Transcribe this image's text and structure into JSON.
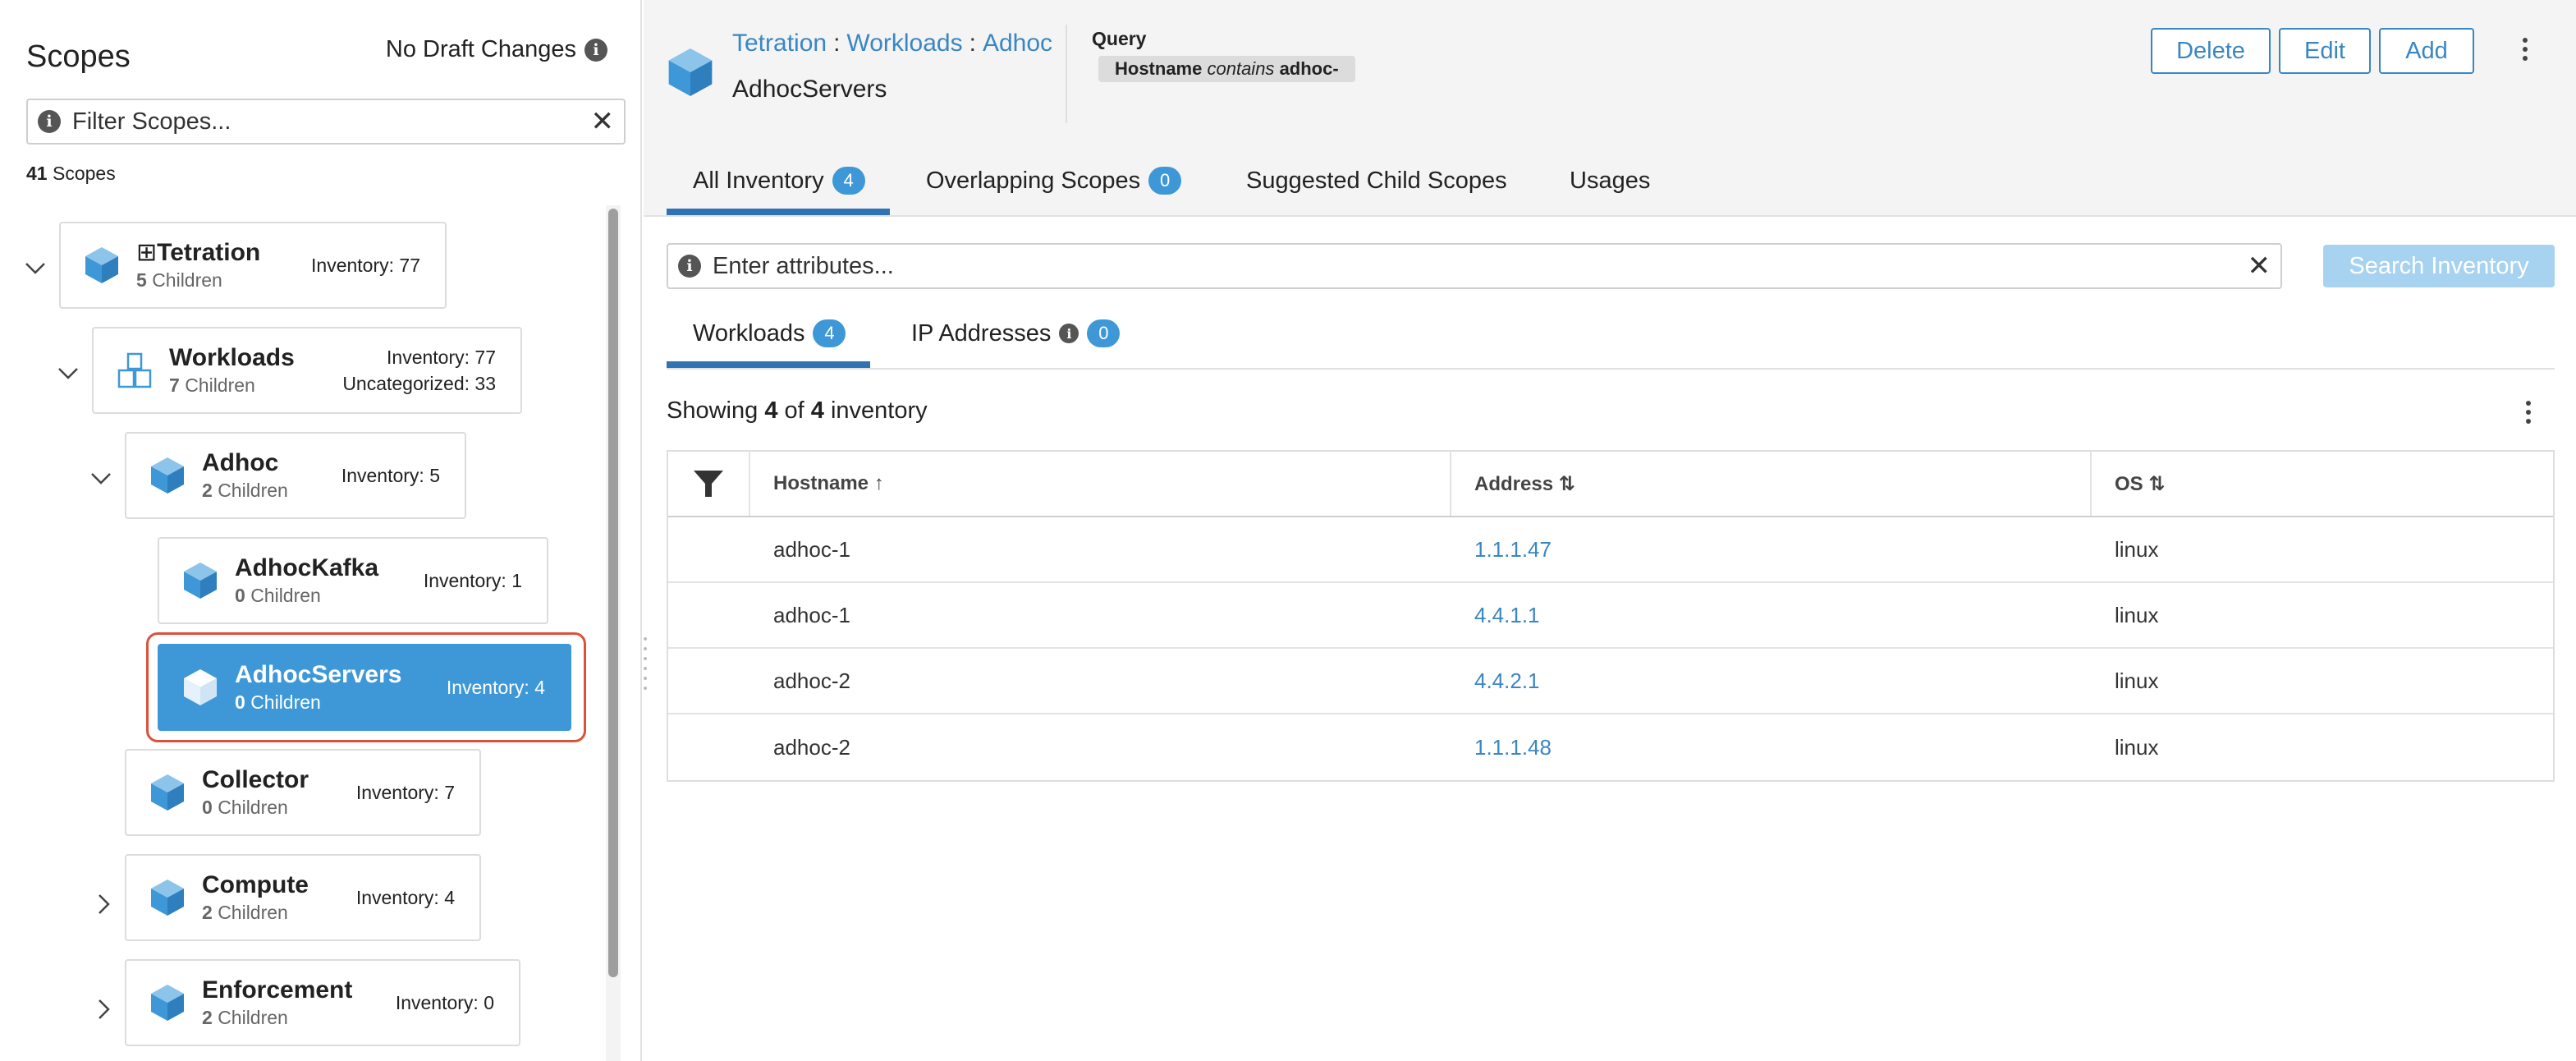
{
  "sidebar": {
    "title": "Scopes",
    "draft_status": "No Draft Changes",
    "filter_placeholder": "Filter Scopes...",
    "scope_count_number": "41",
    "scope_count_label": "Scopes",
    "nodes": [
      {
        "name": "Tetration",
        "children_num": "5",
        "children_label": "Children",
        "inventory": "Inventory: 77",
        "expanded": true
      },
      {
        "name": "Workloads",
        "children_num": "7",
        "children_label": "Children",
        "inventory": "Inventory: 77",
        "uncategorized": "Uncategorized: 33",
        "expanded": true
      },
      {
        "name": "Adhoc",
        "children_num": "2",
        "children_label": "Children",
        "inventory": "Inventory: 5",
        "expanded": true
      },
      {
        "name": "AdhocKafka",
        "children_num": "0",
        "children_label": "Children",
        "inventory": "Inventory: 1"
      },
      {
        "name": "AdhocServers",
        "children_num": "0",
        "children_label": "Children",
        "inventory": "Inventory: 4",
        "selected": true
      },
      {
        "name": "Collector",
        "children_num": "0",
        "children_label": "Children",
        "inventory": "Inventory: 7"
      },
      {
        "name": "Compute",
        "children_num": "2",
        "children_label": "Children",
        "inventory": "Inventory: 4",
        "expanded": false
      },
      {
        "name": "Enforcement",
        "children_num": "2",
        "children_label": "Children",
        "inventory": "Inventory: 0",
        "expanded": false
      }
    ]
  },
  "header": {
    "breadcrumb": [
      "Tetration",
      "Workloads",
      "Adhoc"
    ],
    "breadcrumb_sep": ":",
    "scope_name": "AdhocServers",
    "query_title": "Query",
    "query_field": "Hostname",
    "query_op": "contains",
    "query_value": "adhoc-",
    "buttons": {
      "delete": "Delete",
      "edit": "Edit",
      "add": "Add"
    }
  },
  "tabs": [
    {
      "label": "All Inventory",
      "badge": "4",
      "active": true
    },
    {
      "label": "Overlapping Scopes",
      "badge": "0"
    },
    {
      "label": "Suggested Child Scopes"
    },
    {
      "label": "Usages"
    }
  ],
  "search": {
    "placeholder": "Enter attributes...",
    "button": "Search Inventory"
  },
  "subtabs": [
    {
      "label": "Workloads",
      "badge": "4",
      "active": true
    },
    {
      "label": "IP Addresses",
      "badge": "0"
    }
  ],
  "showing": {
    "prefix": "Showing",
    "shown": "4",
    "of": "of",
    "total": "4",
    "suffix": "inventory"
  },
  "table": {
    "columns": [
      "Hostname ↑",
      "Address ⇅",
      "OS ⇅"
    ],
    "rows": [
      {
        "hostname": "adhoc-1",
        "address": "1.1.1.47",
        "os": "linux"
      },
      {
        "hostname": "adhoc-1",
        "address": "4.4.1.1",
        "os": "linux"
      },
      {
        "hostname": "adhoc-2",
        "address": "4.4.2.1",
        "os": "linux"
      },
      {
        "hostname": "adhoc-2",
        "address": "1.1.1.48",
        "os": "linux"
      }
    ]
  },
  "colors": {
    "accent": "#3e98d7",
    "link": "#3a86c4",
    "selection_ring": "#d9533b",
    "search_button_disabled": "#a7d3f0"
  },
  "icons": [
    "info-icon",
    "close-icon",
    "cube-icon",
    "chevron-down-icon",
    "chevron-right-icon",
    "kebab-menu-icon",
    "filter-funnel-icon",
    "grid-icon"
  ]
}
